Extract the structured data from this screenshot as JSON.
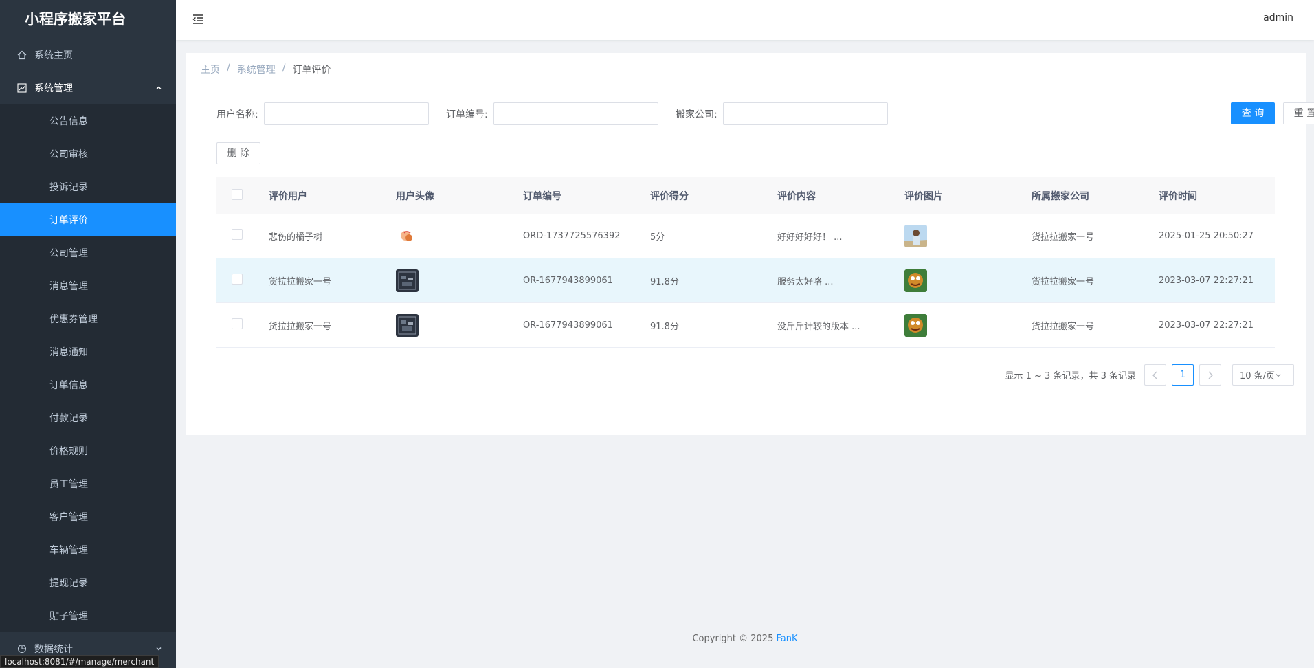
{
  "app": {
    "title": "小程序搬家平台",
    "user": "admin"
  },
  "sidebar": {
    "home": "系统主页",
    "system": "系统管理",
    "items": [
      "公告信息",
      "公司审核",
      "投诉记录",
      "订单评价",
      "公司管理",
      "消息管理",
      "优惠券管理",
      "消息通知",
      "订单信息",
      "付款记录",
      "价格规则",
      "员工管理",
      "客户管理",
      "车辆管理",
      "提现记录",
      "贴子管理"
    ],
    "active": "订单评价",
    "stats": "数据统计"
  },
  "status_url": "localhost:8081/#/manage/merchant",
  "breadcrumb": [
    "主页",
    "系统管理",
    "订单评价"
  ],
  "search": {
    "user_label": "用户名称:",
    "order_label": "订单编号:",
    "company_label": "搬家公司:",
    "query_button": "查 询",
    "reset_button": "重 置"
  },
  "delete_button": "删 除",
  "table": {
    "headers": [
      "评价用户",
      "用户头像",
      "订单编号",
      "评价得分",
      "评价内容",
      "评价图片",
      "所属搬家公司",
      "评价时间"
    ],
    "rows": [
      {
        "user": "悲伤的橘子树",
        "order": "ORD-1737725576392",
        "score": "5分",
        "content": "好好好好好！ ...",
        "company": "货拉拉搬家一号",
        "time": "2025-01-25 20:50:27"
      },
      {
        "user": "货拉拉搬家一号",
        "order": "OR-1677943899061",
        "score": "91.8分",
        "content": "服务太好咯 ...",
        "company": "货拉拉搬家一号",
        "time": "2023-03-07 22:27:21"
      },
      {
        "user": "货拉拉搬家一号",
        "order": "OR-1677943899061",
        "score": "91.8分",
        "content": "没斤斤计较的版本 ...",
        "company": "货拉拉搬家一号",
        "time": "2023-03-07 22:27:21"
      }
    ]
  },
  "pagination": {
    "summary": "显示 1 ~ 3 条记录，共 3 条记录",
    "current": "1",
    "page_size": "10 条/页"
  },
  "footer": {
    "copyright": "Copyright © 2025",
    "brand": "FanK"
  },
  "colors": {
    "accent": "#1890ff",
    "sidebar_bg": "#2b3540",
    "row_highlight": "#e8f6fc"
  }
}
